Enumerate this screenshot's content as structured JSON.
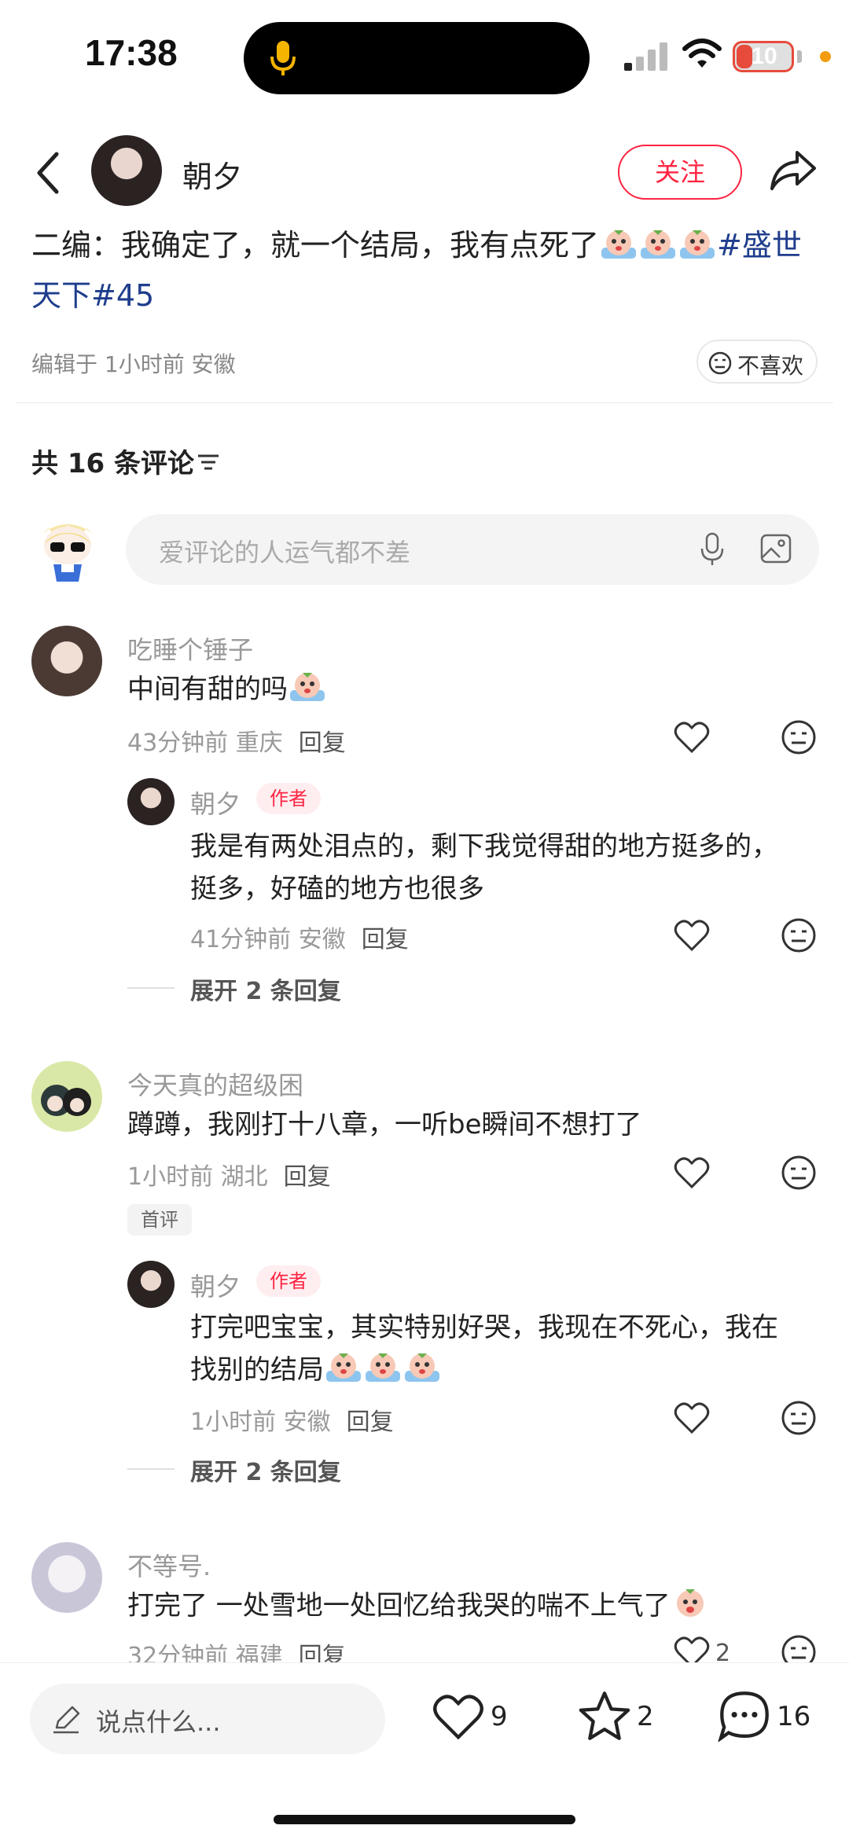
{
  "status_bar": {
    "time": "17:38",
    "battery": "10"
  },
  "header": {
    "author_name": "朝夕",
    "follow_label": "关注"
  },
  "post": {
    "text_before": "二编：我确定了，就一个结局，我有点死了",
    "hashtag": "#盛世天下#45",
    "meta": "编辑于 1小时前 安徽",
    "dislike_label": "不喜欢"
  },
  "comments_section": {
    "count_label": "共 16 条评论",
    "input_placeholder": "爱评论的人运气都不差"
  },
  "comments": [
    {
      "name": "吃睡个锤子",
      "text": "中间有甜的吗",
      "meta": "43分钟前 重庆",
      "reply_label": "回复",
      "reply": {
        "name": "朝夕",
        "badge": "作者",
        "text_line1": "我是有两处泪点的，剩下我觉得甜的地方挺多的，",
        "text_line2": "挺多，好磕的地方也很多",
        "meta": "41分钟前 安徽",
        "reply_label": "回复"
      },
      "expand_label": "展开 2 条回复"
    },
    {
      "name": "今天真的超级困",
      "text": "蹲蹲，我刚打十八章，一听be瞬间不想打了",
      "meta": "1小时前 湖北",
      "reply_label": "回复",
      "badge": "首评",
      "reply": {
        "name": "朝夕",
        "badge": "作者",
        "text_line1": "打完吧宝宝，其实特别好哭，我现在不死心，我在",
        "text_line2": "找别的结局",
        "meta": "1小时前 安徽",
        "reply_label": "回复"
      },
      "expand_label": "展开 2 条回复"
    },
    {
      "name": "不等号.",
      "text": "打完了 一处雪地一处回忆给我哭的喘不上气了",
      "meta": "32分钟前 福建",
      "reply_label": "回复",
      "like_count": "2"
    }
  ],
  "bottom_bar": {
    "input_placeholder": "说点什么...",
    "like_count": "9",
    "collect_count": "2",
    "comment_count": "16"
  },
  "colors": {
    "accent": "#ff2442",
    "hashtag": "#1f3d8c",
    "battery": "#e74b3c"
  }
}
